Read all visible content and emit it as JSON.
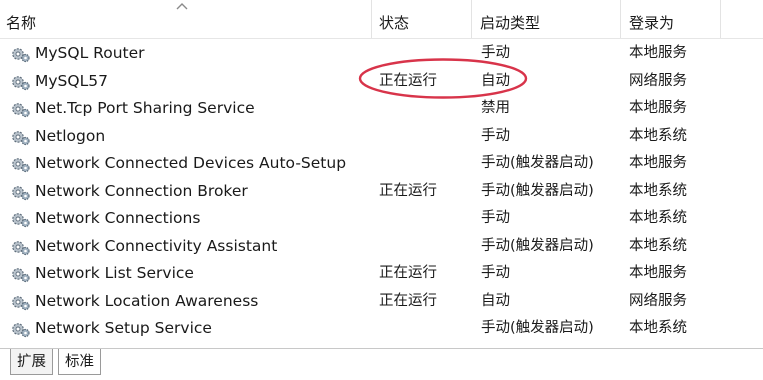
{
  "columns": {
    "name": "名称",
    "status": "状态",
    "startup_type": "启动类型",
    "logon_as": "登录为"
  },
  "services": [
    {
      "name": "MySQL Router",
      "status": "",
      "startup_type": "手动",
      "logon_as": "本地服务"
    },
    {
      "name": "MySQL57",
      "status": "正在运行",
      "startup_type": "自动",
      "logon_as": "网络服务"
    },
    {
      "name": "Net.Tcp Port Sharing Service",
      "status": "",
      "startup_type": "禁用",
      "logon_as": "本地服务"
    },
    {
      "name": "Netlogon",
      "status": "",
      "startup_type": "手动",
      "logon_as": "本地系统"
    },
    {
      "name": "Network Connected Devices Auto-Setup",
      "status": "",
      "startup_type": "手动(触发器启动)",
      "logon_as": "本地服务"
    },
    {
      "name": "Network Connection Broker",
      "status": "正在运行",
      "startup_type": "手动(触发器启动)",
      "logon_as": "本地系统"
    },
    {
      "name": "Network Connections",
      "status": "",
      "startup_type": "手动",
      "logon_as": "本地系统"
    },
    {
      "name": "Network Connectivity Assistant",
      "status": "",
      "startup_type": "手动(触发器启动)",
      "logon_as": "本地系统"
    },
    {
      "name": "Network List Service",
      "status": "正在运行",
      "startup_type": "手动",
      "logon_as": "本地服务"
    },
    {
      "name": "Network Location Awareness",
      "status": "正在运行",
      "startup_type": "自动",
      "logon_as": "网络服务"
    },
    {
      "name": "Network Setup Service",
      "status": "",
      "startup_type": "手动(触发器启动)",
      "logon_as": "本地系统"
    }
  ],
  "tabs": [
    {
      "label": "扩展"
    },
    {
      "label": "标准"
    }
  ],
  "colors": {
    "annotation": "#d8344a",
    "header_border": "#e6e6e6"
  },
  "icons": {
    "service": "gears-icon",
    "sort": "sort-ascending-icon"
  }
}
